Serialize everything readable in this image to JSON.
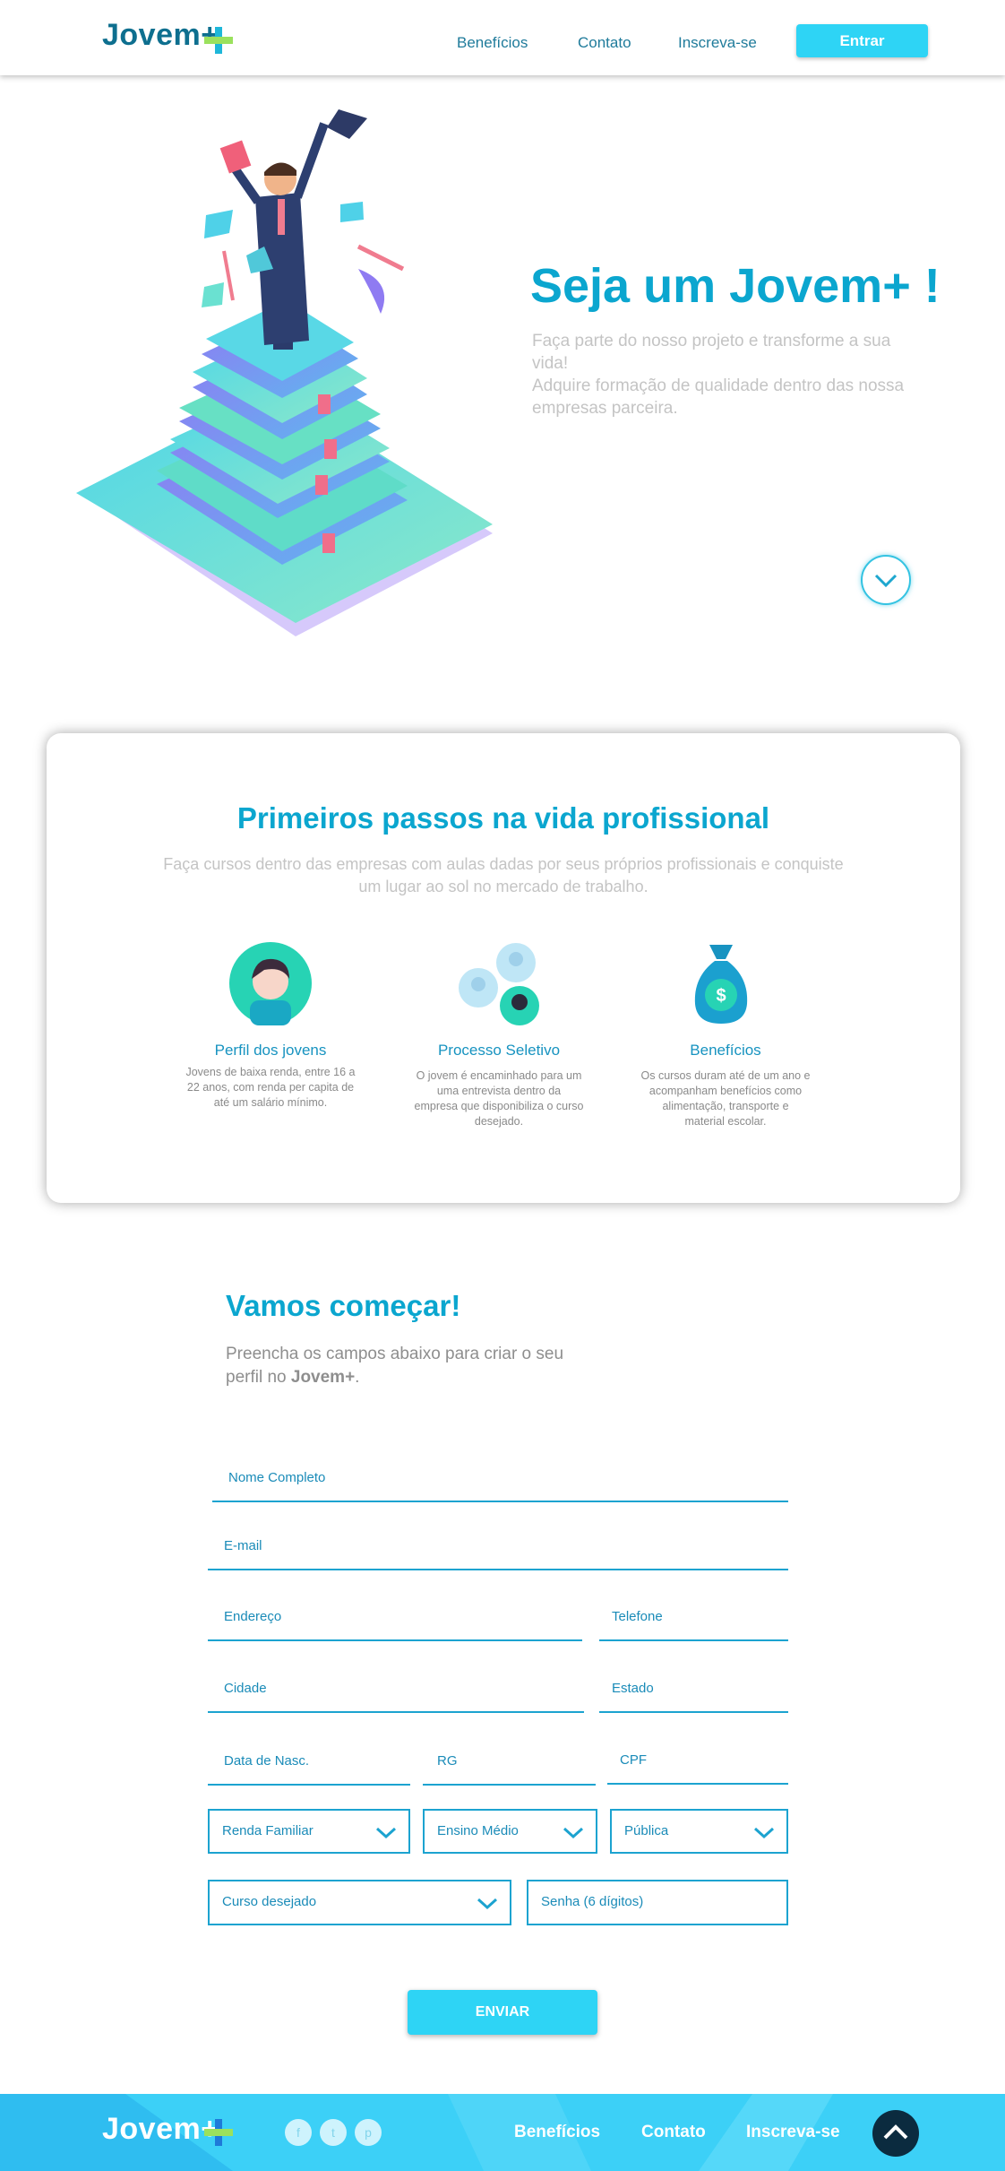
{
  "header": {
    "logo": "Jovem+",
    "nav": [
      "Benefícios",
      "Contato",
      "Inscreva-se"
    ],
    "login_button": "Entrar"
  },
  "hero": {
    "title": "Seja um Jovem+ !",
    "lines": [
      "Faça parte do nosso projeto e transforme a sua",
      "vida!",
      "Adquire formação de qualidade dentro das nossa",
      "empresas parceira."
    ]
  },
  "intro": {
    "title": "Primeiros passos na vida profissional",
    "subtitle_lines": [
      "Faça cursos dentro das empresas com aulas dadas por seus próprios profissionais e conquiste",
      "um lugar ao sol no mercado de trabalho."
    ],
    "features": [
      {
        "title": "Perfil dos jovens",
        "desc": [
          "Jovens de baixa renda, entre 16 a",
          "22 anos, com renda per capita de",
          "até um salário mínimo."
        ]
      },
      {
        "title": "Processo Seletivo",
        "desc": [
          "O jovem é encaminhado para um",
          "uma entrevista dentro da",
          "empresa que disponibiliza o curso",
          "desejado."
        ]
      },
      {
        "title": "Benefícios",
        "desc": [
          "Os cursos duram até de um ano e",
          "acompanham benefícios como",
          "alimentação, transporte e",
          "material escolar."
        ]
      }
    ]
  },
  "form": {
    "title": "Vamos começar!",
    "subtitle_line1": "Preencha os campos abaixo para criar o seu",
    "subtitle_line2_prefix": "perfil no ",
    "subtitle_brand": "Jovem+",
    "subtitle_suffix": ".",
    "fields": {
      "nome": "Nome Completo",
      "email": "E-mail",
      "endereco": "Endereço",
      "telefone": "Telefone",
      "cidade": "Cidade",
      "estado": "Estado",
      "nascimento": "Data de Nasc.",
      "rg": "RG",
      "cpf": "CPF",
      "renda": "Renda Familiar",
      "ensino": "Ensino Médio",
      "escola": "Pública",
      "curso": "Curso desejado",
      "senha": "Senha (6 dígitos)"
    },
    "submit": "ENVIAR"
  },
  "footer": {
    "logo": "Jovem+",
    "social": [
      "f",
      "t",
      "p"
    ],
    "nav": [
      "Benefícios",
      "Contato",
      "Inscreva-se"
    ]
  },
  "colors": {
    "primary": "#0ba6cf",
    "accent": "#2ed4f5",
    "dark": "#0b2b3f"
  }
}
